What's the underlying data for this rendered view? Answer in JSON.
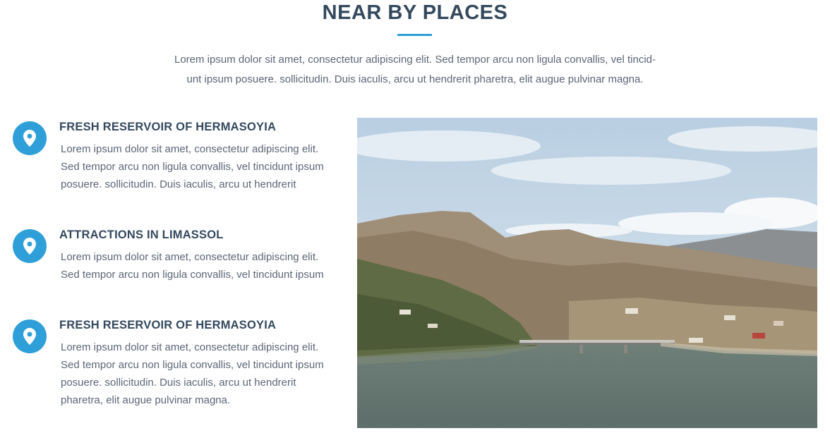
{
  "section": {
    "title": "NEAR BY PLACES",
    "intro_line1": "Lorem ipsum dolor sit amet, consectetur adipiscing elit. Sed tempor arcu non ligula convallis, vel tincid-",
    "intro_line2": "unt ipsum posuere. sollicitudin. Duis iaculis, arcu ut hendrerit pharetra, elit augue pulvinar magna."
  },
  "places": [
    {
      "title": "FRESH RESERVOIR OF HERMASOYIA",
      "lines": [
        "Lorem ipsum dolor sit amet, consectetur adipiscing elit.",
        "Sed tempor arcu non ligula convallis, vel tincidunt ipsum",
        "posuere. sollicitudin. Duis iaculis, arcu ut hendrerit"
      ]
    },
    {
      "title": "ATTRACTIONS IN LIMASSOL",
      "lines": [
        "Lorem ipsum dolor sit amet, consectetur adipiscing elit.",
        "Sed tempor arcu non ligula convallis, vel tincidunt ipsum"
      ]
    },
    {
      "title": "FRESH RESERVOIR OF HERMASOYIA",
      "lines": [
        "Lorem ipsum dolor sit amet, consectetur adipiscing elit.",
        "Sed tempor arcu non ligula convallis, vel tincidunt ipsum",
        "posuere. sollicitudin. Duis iaculis, arcu ut hendrerit",
        "pharetra, elit augue pulvinar magna."
      ]
    }
  ],
  "icons": {
    "place": "map-pin-icon"
  },
  "colors": {
    "accent": "#2e9fd9",
    "heading": "#34495e",
    "body_text": "#5c6677"
  }
}
